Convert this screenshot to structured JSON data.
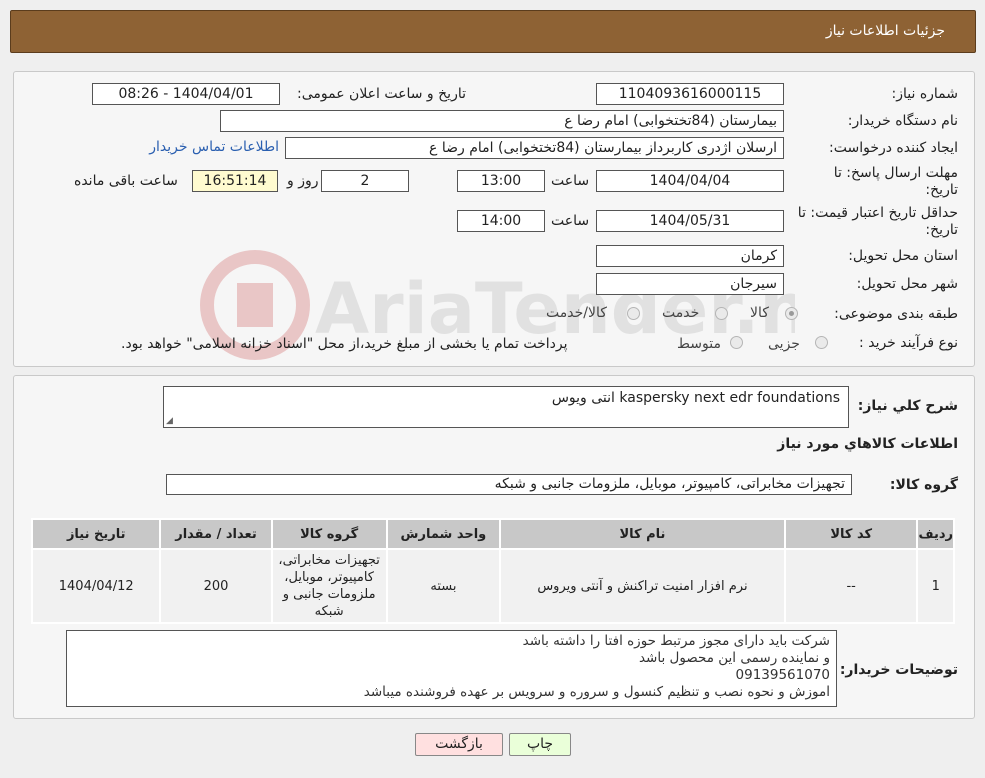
{
  "header": {
    "title": "جزئیات اطلاعات نیاز"
  },
  "form": {
    "need_number_label": "شماره نیاز:",
    "need_number": "1104093616000115",
    "announce_label": "تاریخ و ساعت اعلان عمومی:",
    "announce_value": "1404/04/01 - 08:26",
    "buyer_org_label": "نام دستگاه خریدار:",
    "buyer_org": "بیمارستان (84تختخوابی) امام رضا  ع",
    "creator_label": "ایجاد کننده درخواست:",
    "creator": "ارسلان اژدری کاربرداز بیمارستان (84تختخوابی) امام رضا  ع",
    "contact_link": "اطلاعات تماس خریدار",
    "deadline_label_1": "مهلت ارسال پاسخ: تا",
    "deadline_label_2": "تاریخ:",
    "deadline_date": "1404/04/04",
    "time_label": "ساعت",
    "deadline_time": "13:00",
    "days_value": "2",
    "days_label": "روز و",
    "remaining_time": "16:51:14",
    "remaining_label": "ساعت باقی مانده",
    "validity_label_1": "حداقل تاریخ اعتبار قیمت: تا",
    "validity_label_2": "تاریخ:",
    "validity_date": "1404/05/31",
    "validity_time": "14:00",
    "province_label": "استان محل تحویل:",
    "province": "کرمان",
    "city_label": "شهر محل تحویل:",
    "city": "سیرجان",
    "category_label": "طبقه بندی موضوعی:",
    "category_options": [
      "کالا",
      "خدمت",
      "کالا/خدمت"
    ],
    "category_selected": 0,
    "process_label": "نوع فرآیند خرید :",
    "process_options": [
      "جزیی",
      "متوسط"
    ],
    "process_note": "پرداخت تمام یا بخشی از مبلغ خرید،از محل \"اسناد خزانه اسلامی\" خواهد بود."
  },
  "details": {
    "summary_label": "شرح کلي نياز:",
    "summary": "انتی ویوس kaspersky next edr foundations",
    "items_heading": "اطلاعات کالاهاي مورد نياز",
    "group_label": "گروه کالا:",
    "group_value": "تجهیزات مخابراتی، کامپیوتر، موبایل، ملزومات جانبی و شبکه"
  },
  "table": {
    "headers": [
      "ردیف",
      "کد کالا",
      "نام کالا",
      "واحد شمارش",
      "گروه کالا",
      "تعداد / مقدار",
      "تاریخ نیاز"
    ],
    "rows": [
      [
        "1",
        "--",
        "نرم افزار امنیت تراکنش و آنتی ویروس",
        "بسته",
        "تجهیزات مخابراتی، کامپیوتر، موبایل، ملزومات جانبی و شبکه",
        "200",
        "1404/04/12"
      ]
    ]
  },
  "notes": {
    "label": "توضیحات خریدار:",
    "lines": [
      "شرکت باید دارای مجوز مرتبط حوزه افتا را داشته باشد",
      "و نماینده رسمی این محصول باشد",
      "09139561070",
      "اموزش و نحوه نصب و تنظیم کنسول و سروره و سرویس بر عهده فروشنده میباشد"
    ]
  },
  "buttons": {
    "print": "چاپ",
    "back": "بازگشت"
  },
  "colors": {
    "header_bg": "#8e6234",
    "print_btn": "#eaffd9",
    "back_btn": "#ffe0e0"
  }
}
